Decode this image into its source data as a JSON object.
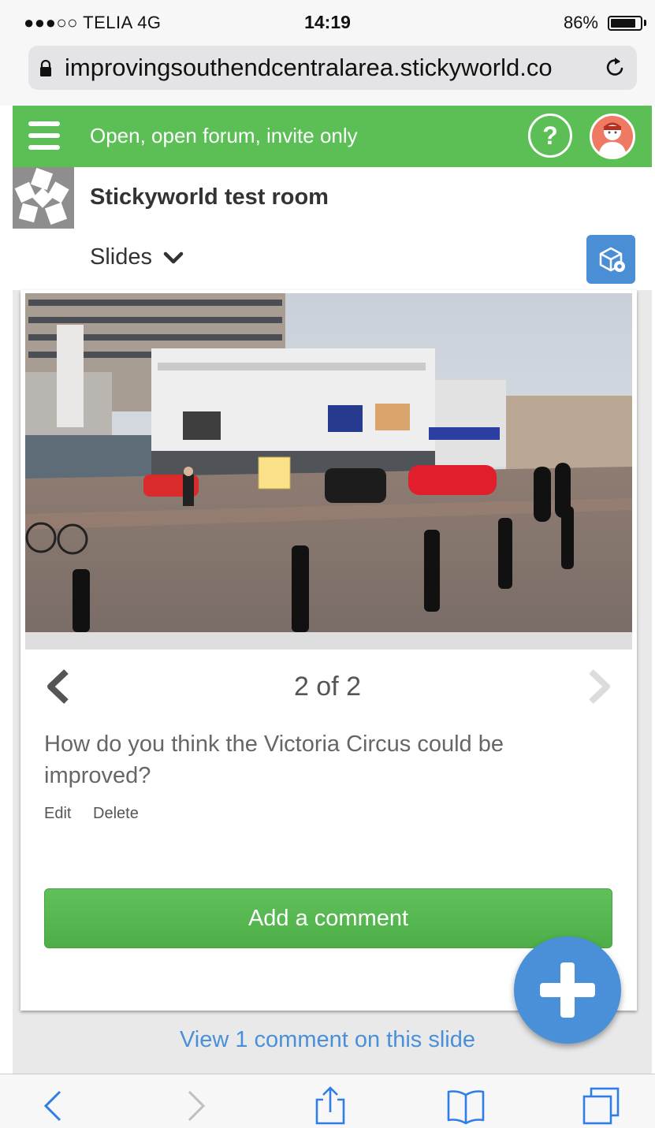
{
  "status": {
    "carrier": "●●●○○ TELIA  4G",
    "time": "14:19",
    "battery": "86%",
    "battery_level": 0.86
  },
  "browser": {
    "url": "improvingsouthendcentralarea.stickyworld.co"
  },
  "header": {
    "title": "Open, open forum, invite only",
    "help": "?"
  },
  "room": {
    "name": "Stickyworld test room",
    "view_selector": "Slides"
  },
  "slide": {
    "counter": "2 of 2",
    "question": "How do you think the Victoria Circus could be improved?",
    "edit": "Edit",
    "delete": "Delete"
  },
  "comments": {
    "add_label": "Add a comment",
    "view_label": "View 1 comment on this slide"
  },
  "colors": {
    "green": "#5cbf55",
    "blue": "#4a90d9"
  }
}
